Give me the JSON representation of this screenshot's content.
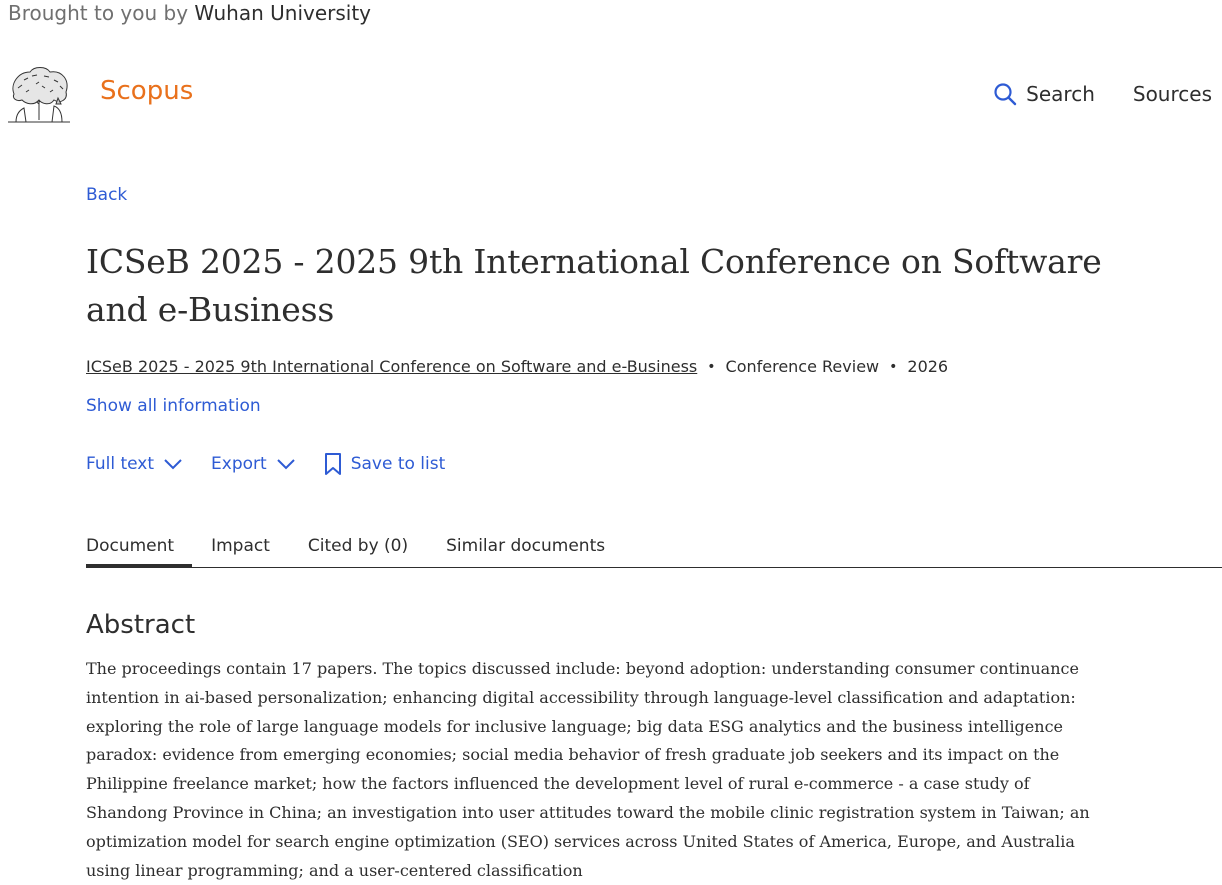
{
  "header": {
    "brought_prefix": "Brought to you by",
    "institution": "Wuhan University",
    "brand": "Scopus",
    "nav": {
      "search_label": "Search",
      "sources_label": "Sources"
    }
  },
  "page": {
    "back_label": "Back",
    "title": "ICSeB 2025 - 2025 9th International Conference on Software and e-Business",
    "meta": {
      "source": "ICSeB 2025 - 2025 9th International Conference on Software and e-Business",
      "separator": "•",
      "doc_type": "Conference Review",
      "year": "2026"
    },
    "show_all_label": "Show all information",
    "actions": {
      "full_text_label": "Full text",
      "export_label": "Export",
      "save_label": "Save to list"
    },
    "tabs": [
      {
        "label": "Document",
        "active": true
      },
      {
        "label": "Impact",
        "active": false
      },
      {
        "label": "Cited by (0)",
        "active": false
      },
      {
        "label": "Similar documents",
        "active": false
      }
    ],
    "abstract": {
      "heading": "Abstract",
      "text": "The proceedings contain 17 papers. The topics discussed include: beyond adoption: understanding consumer continuance intention in ai-based personalization; enhancing digital accessibility through language-level classification and adaptation: exploring the role of large language models for inclusive language; big data ESG analytics and the business intelligence paradox: evidence from emerging economies; social media behavior of fresh graduate job seekers and its impact on the Philippine freelance market; how the factors influenced the development level of rural e-commerce - a case study of Shandong Province in China; an investigation into user attitudes toward the mobile clinic registration system in Taiwan; an optimization model for search engine optimization (SEO) services across United States of America, Europe, and Australia using linear programming; and a user-centered classification"
    }
  },
  "colors": {
    "brand": "#e9711c",
    "link": "#2e5bd4",
    "text": "#2e2e2e",
    "muted": "#707070"
  },
  "icons": {
    "logo": "elsevier-tree-logo",
    "search": "search-icon",
    "chevron": "chevron-down-icon",
    "bookmark": "bookmark-icon"
  }
}
